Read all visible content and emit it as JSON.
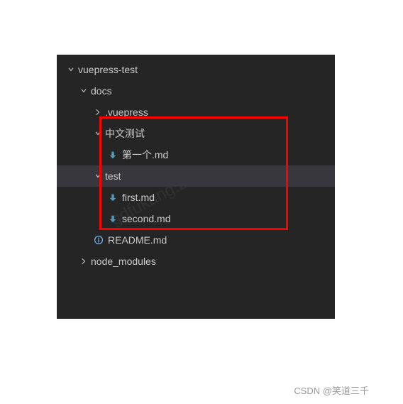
{
  "tree": {
    "root": "vuepress-test",
    "docs": "docs",
    "vuepress": ".vuepress",
    "zh_test": "中文测试",
    "zh_first": "第一个.md",
    "test": "test",
    "first": "first.md",
    "second": "second.md",
    "readme": "README.md",
    "node_modules": "node_modules"
  },
  "attribution": "CSDN @笑道三千",
  "watermark": "gdfukang.zh",
  "colors": {
    "bg": "#252526",
    "row_hover": "#37373d",
    "text": "#cccccc",
    "highlight": "#ff0000",
    "md_icon": "#519aba",
    "info_icon": "#75beff"
  }
}
